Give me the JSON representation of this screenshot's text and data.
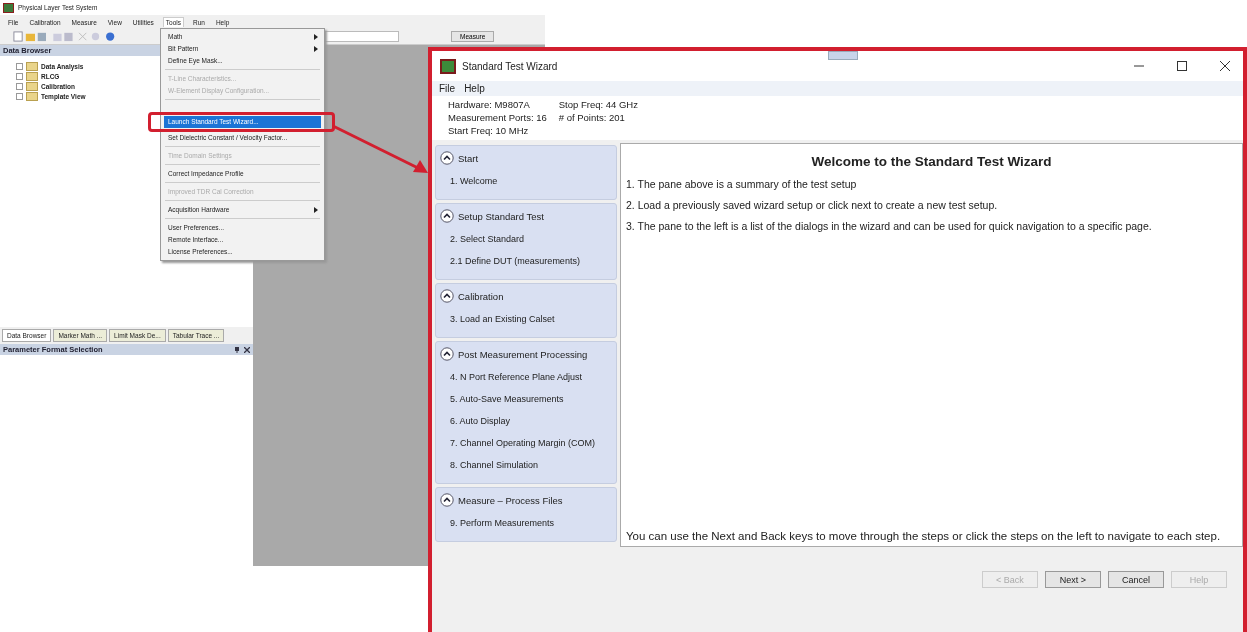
{
  "app": {
    "title": "Physical Layer Test System",
    "menu": [
      {
        "label": "File",
        "selected": false
      },
      {
        "label": "Calibration",
        "selected": false
      },
      {
        "label": "Measure",
        "selected": false
      },
      {
        "label": "View",
        "selected": false
      },
      {
        "label": "Utilities",
        "selected": false
      },
      {
        "label": "Tools",
        "selected": true
      },
      {
        "label": "Run",
        "selected": false
      },
      {
        "label": "Help",
        "selected": false
      }
    ],
    "data_browser": {
      "title": "Data Browser",
      "items": [
        {
          "label": "Data Analysis"
        },
        {
          "label": "RLCG"
        },
        {
          "label": "Calibration"
        },
        {
          "label": "Template View"
        }
      ]
    },
    "measure_button": "Measure",
    "bottom_tabs": [
      {
        "label": "Data Browser",
        "selected": true
      },
      {
        "label": "Marker Math ...",
        "selected": false
      },
      {
        "label": "Limit Mask De...",
        "selected": false
      },
      {
        "label": "Tabular Trace ...",
        "selected": false
      }
    ],
    "parameter_panel": {
      "title": "Parameter Format Selection"
    }
  },
  "tools_menu": [
    {
      "kind": "item",
      "label": "Math",
      "disabled": false,
      "submenu": true,
      "highlighted": false
    },
    {
      "kind": "item",
      "label": "Bit Pattern",
      "disabled": false,
      "submenu": true,
      "highlighted": false
    },
    {
      "kind": "item",
      "label": "Define Eye Mask...",
      "disabled": false,
      "submenu": false,
      "highlighted": false
    },
    {
      "kind": "separator"
    },
    {
      "kind": "item",
      "label": "T-Line Characteristics...",
      "disabled": true,
      "submenu": false,
      "highlighted": false
    },
    {
      "kind": "item",
      "label": "W-Element Display Configuration...",
      "disabled": true,
      "submenu": false,
      "highlighted": false
    },
    {
      "kind": "separator"
    },
    {
      "kind": "item",
      "label": "Launch Standard Test Wizard...",
      "disabled": false,
      "submenu": false,
      "highlighted": true
    },
    {
      "kind": "item",
      "label": "Set Dielectric Constant / Velocity Factor...",
      "disabled": false,
      "submenu": false,
      "highlighted": false
    },
    {
      "kind": "separator"
    },
    {
      "kind": "item",
      "label": "Time Domain Settings",
      "disabled": true,
      "submenu": false,
      "highlighted": false
    },
    {
      "kind": "separator"
    },
    {
      "kind": "item",
      "label": "Correct Impedance Profile",
      "disabled": false,
      "submenu": false,
      "highlighted": false
    },
    {
      "kind": "separator"
    },
    {
      "kind": "item",
      "label": "Improved TDR Cal Correction",
      "disabled": true,
      "submenu": false,
      "highlighted": false
    },
    {
      "kind": "separator"
    },
    {
      "kind": "item",
      "label": "Acquisition Hardware",
      "disabled": false,
      "submenu": true,
      "highlighted": false
    },
    {
      "kind": "separator"
    },
    {
      "kind": "item",
      "label": "User Preferences...",
      "disabled": false,
      "submenu": false,
      "highlighted": false
    },
    {
      "kind": "item",
      "label": "Remote Interface...",
      "disabled": false,
      "submenu": false,
      "highlighted": false
    },
    {
      "kind": "item",
      "label": "License Preferences...",
      "disabled": false,
      "submenu": false,
      "highlighted": false
    }
  ],
  "wizard": {
    "title": "Standard Test Wizard",
    "menu": [
      "File",
      "Help"
    ],
    "summary": [
      [
        "Hardware: M9807A",
        "Measurement Ports: 16",
        "Start Freq: 10 MHz"
      ],
      [
        "Stop Freq: 44 GHz",
        "# of Points: 201"
      ]
    ],
    "sections": [
      {
        "title": "Start",
        "expanded": true,
        "steps": [
          "1. Welcome"
        ]
      },
      {
        "title": "Setup Standard Test",
        "expanded": true,
        "steps": [
          "2. Select Standard",
          "2.1 Define DUT   (measurements)"
        ]
      },
      {
        "title": "Calibration",
        "expanded": true,
        "steps": [
          "3. Load an Existing Calset"
        ]
      },
      {
        "title": "Post Measurement Processing",
        "expanded": true,
        "steps": [
          "4. N Port Reference Plane Adjust",
          "5. Auto-Save Measurements",
          "6. Auto Display",
          "7. Channel Operating Margin (COM)",
          "8. Channel Simulation"
        ]
      },
      {
        "title": "Measure – Process Files",
        "expanded": true,
        "steps": [
          "9. Perform Measurements"
        ]
      }
    ],
    "heading": "Welcome to the Standard Test Wizard",
    "instructions": [
      "1. The pane above is a summary of the test setup",
      "2. Load a previously saved wizard setup or click next to create a new test setup.",
      "3. The pane to the left is a list of the dialogs in the wizard and can be used  for quick navigation to a specific page."
    ],
    "footer_note": "You can use the Next and Back keys to move through the steps or click the steps on the left to navigate to each step.",
    "buttons": [
      {
        "label": "< Back",
        "disabled": true
      },
      {
        "label": "Next >",
        "disabled": false
      },
      {
        "label": "Cancel",
        "disabled": false
      },
      {
        "label": "Help",
        "disabled": true
      }
    ]
  }
}
